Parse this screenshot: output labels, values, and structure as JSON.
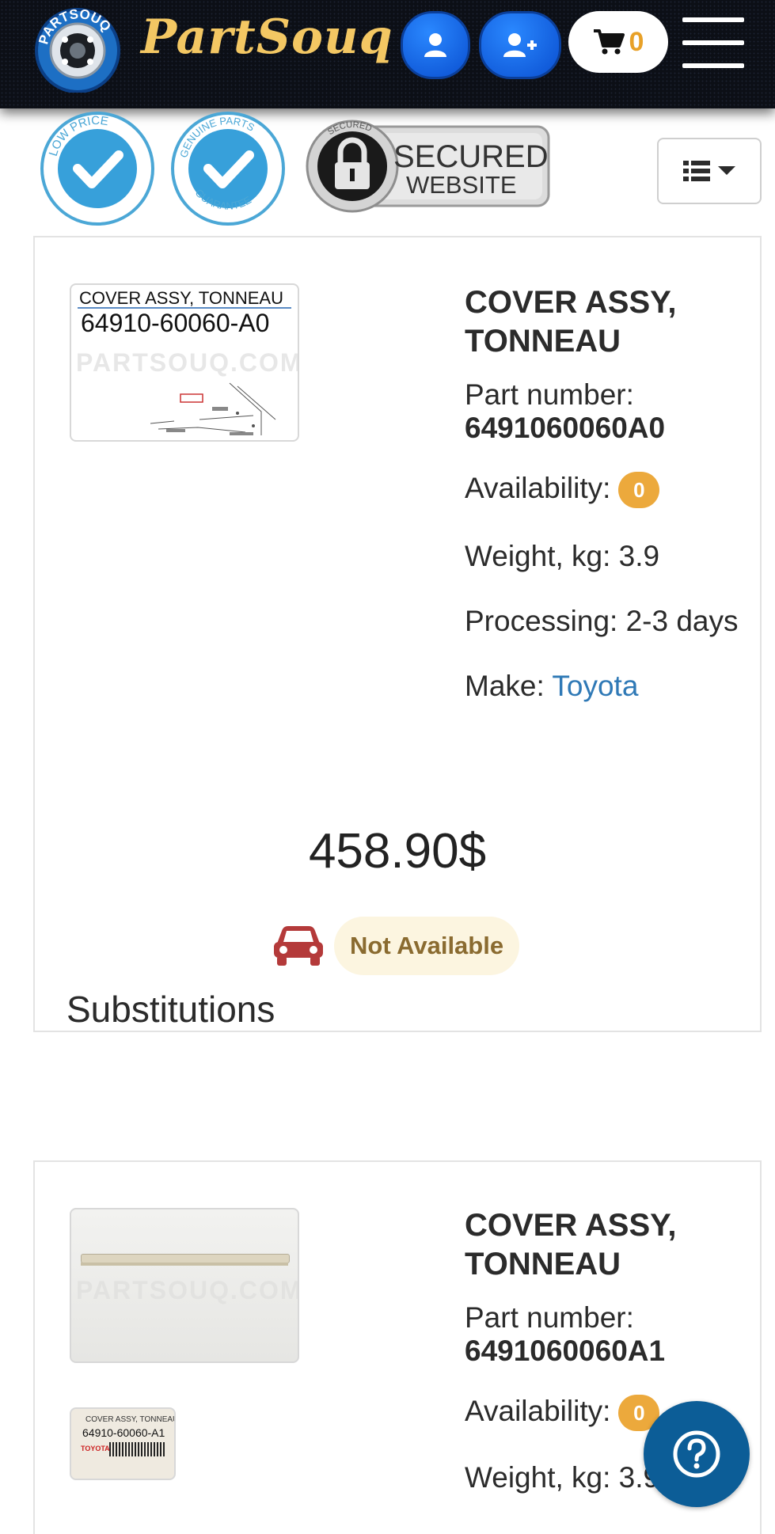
{
  "header": {
    "logo_ring_text": "PARTSOUQ",
    "logo_text": "PartSouq",
    "cart_count": "0"
  },
  "badges": {
    "low_price": "LOW PRICE",
    "genuine": "GENUINE PARTS",
    "guarantee": "GUARANTEE",
    "secured_small": "SECURED",
    "secured_line1": "SECURED",
    "secured_line2": "WEBSITE"
  },
  "main_product": {
    "thumb_label": "COVER ASSY, TONNEAU",
    "thumb_code": "64910-60060-A0",
    "watermark": "PARTSOUQ.COM",
    "title_line1": "COVER ASSY,",
    "title_line2": "TONNEAU",
    "part_number_label": "Part number:",
    "part_number": "6491060060A0",
    "availability_label": "Availability:",
    "availability_count": "0",
    "weight": "Weight, kg: 3.9",
    "processing": "Processing: 2-3 days",
    "make_label": "Make:",
    "make_value": "Toyota",
    "price": "458.90$",
    "status": "Not Available"
  },
  "substitutions": {
    "heading": "Substitutions",
    "item": {
      "watermark": "PARTSOUQ.COM",
      "label_text1": "COVER ASSY, TONNEAU",
      "label_text2": "64910-60060-A1",
      "label_brand": "TOYOTA",
      "title_line1": "COVER ASSY,",
      "title_line2": "TONNEAU",
      "part_number_label": "Part number:",
      "part_number": "6491060060A1",
      "availability_label": "Availability:",
      "availability_count": "0",
      "weight": "Weight, kg: 3.9"
    }
  },
  "colors": {
    "brand_gold": "#f3c763",
    "button_blue": "#0a4fd0",
    "badge_orange": "#eca93c",
    "link_blue": "#2f79b6",
    "car_red": "#b43a3a",
    "help_blue": "#0c5d97"
  },
  "icons": [
    "user-icon",
    "add-user-icon",
    "cart-icon",
    "hamburger-menu-icon",
    "list-view-icon",
    "caret-down-icon",
    "car-icon",
    "question-icon"
  ]
}
